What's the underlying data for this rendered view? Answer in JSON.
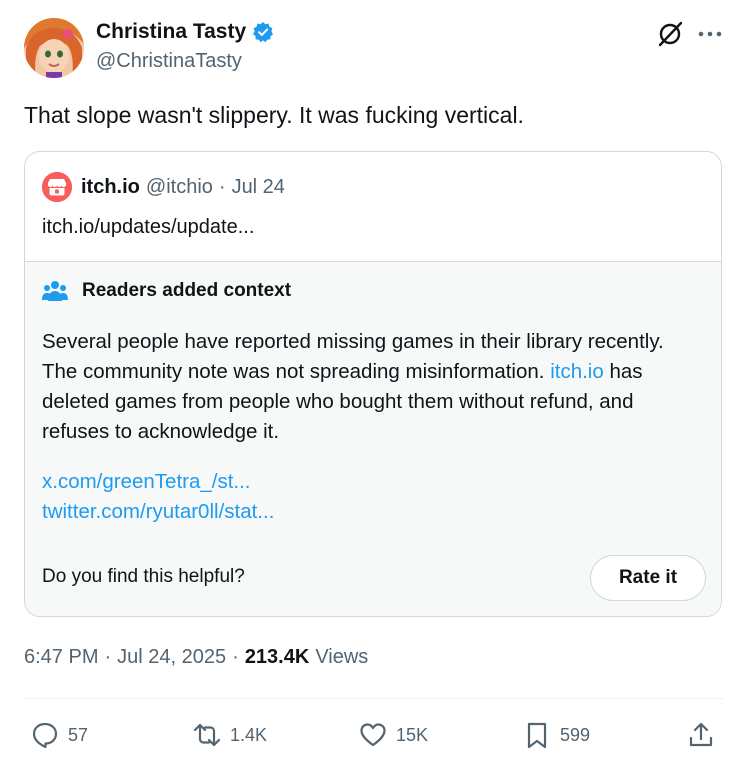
{
  "author": {
    "display_name": "Christina Tasty",
    "handle": "@ChristinaTasty"
  },
  "tweet": {
    "text": "That slope wasn't slippery. It was fucking vertical."
  },
  "quote": {
    "name": "itch.io",
    "handle": "@itchio",
    "date": "Jul 24",
    "separator": "·",
    "link_text": "itch.io/updates/update..."
  },
  "community_note": {
    "title": "Readers added context",
    "body_part1": "Several people have reported missing games in their library recently. The community note was not spreading misinformation. ",
    "body_link": "itch.io",
    "body_part2": " has deleted games from people who bought them without refund, and refuses to acknowledge it.",
    "links": [
      "x.com/greenTetra_/st...",
      "twitter.com/ryutar0ll/stat..."
    ],
    "helpful_prompt": "Do you find this helpful?",
    "rate_label": "Rate it"
  },
  "meta": {
    "time": "6:47 PM",
    "date": "Jul 24, 2025",
    "separator": "·",
    "views_count": "213.4K",
    "views_label": "Views"
  },
  "actions": {
    "replies": "57",
    "reposts": "1.4K",
    "likes": "15K",
    "bookmarks": "599"
  },
  "colors": {
    "verified": "#1d9bf0",
    "link": "#1d9bf0",
    "itch_brand": "#fa5c5c",
    "secondary_text": "#536471"
  }
}
